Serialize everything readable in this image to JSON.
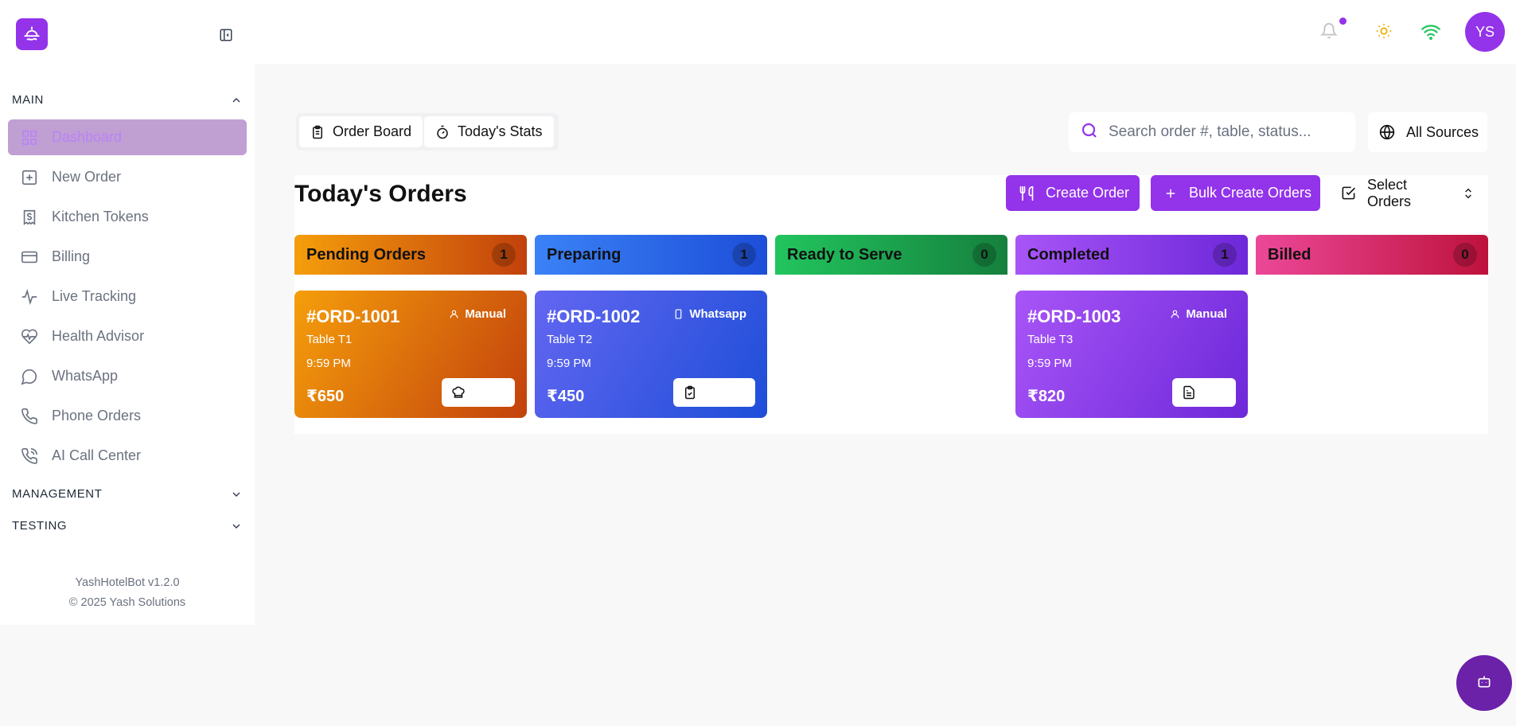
{
  "header": {
    "avatar_initials": "YS",
    "notification_dot": true,
    "icons": [
      "logo-icon",
      "sidebar-toggle-icon",
      "bell-icon",
      "sun-icon",
      "wifi-icon"
    ]
  },
  "sidebar": {
    "main_section": "MAIN",
    "items": [
      {
        "label": "Dashboard",
        "icon": "grid-icon",
        "active": true
      },
      {
        "label": "New Order",
        "icon": "plus-square-icon"
      },
      {
        "label": "Kitchen Tokens",
        "icon": "receipt-icon"
      },
      {
        "label": "Billing",
        "icon": "credit-card-icon"
      },
      {
        "label": "Live Tracking",
        "icon": "activity-icon"
      },
      {
        "label": "Health Advisor",
        "icon": "heart-pulse-icon"
      },
      {
        "label": "WhatsApp",
        "icon": "message-circle-icon"
      },
      {
        "label": "Phone Orders",
        "icon": "phone-icon"
      },
      {
        "label": "AI Call Center",
        "icon": "phone-call-icon"
      }
    ],
    "management_section": "MANAGEMENT",
    "testing_section": "TESTING",
    "version": "YashHotelBot v1.2.0",
    "copyright": "© 2025 Yash Solutions"
  },
  "toolbar": {
    "tabs": [
      {
        "label": "Order Board",
        "icon": "clipboard-icon"
      },
      {
        "label": "Today's Stats",
        "icon": "timer-icon"
      }
    ],
    "search_placeholder": "Search order #, table, status...",
    "sources_label": "All Sources"
  },
  "board": {
    "title": "Today's Orders",
    "create_label": "Create Order",
    "bulk_label": "Bulk Create Orders",
    "select_label": "Select Orders",
    "columns": [
      {
        "label": "Pending Orders",
        "count": "1",
        "gradient": [
          "#f59e0b",
          "#c2410c"
        ]
      },
      {
        "label": "Preparing",
        "count": "1",
        "gradient": [
          "#3b82f6",
          "#1d4ed8"
        ]
      },
      {
        "label": "Ready to Serve",
        "count": "0",
        "gradient": [
          "#22c55e",
          "#15803d"
        ]
      },
      {
        "label": "Completed",
        "count": "1",
        "gradient": [
          "#a855f7",
          "#6d28d9"
        ]
      },
      {
        "label": "Billed",
        "count": "0",
        "gradient": [
          "#ec4899",
          "#be123c"
        ]
      }
    ],
    "orders": [
      {
        "id": "#ORD-1001",
        "source": "Manual",
        "table": "Table T1",
        "time": "9:59 PM",
        "price": "₹650",
        "action": "Start",
        "column": 0,
        "gradient": [
          "#f59e0b",
          "#c2410c"
        ]
      },
      {
        "id": "#ORD-1002",
        "source": "Whatsapp",
        "table": "Table T2",
        "time": "9:59 PM",
        "price": "₹450",
        "action": "Ready",
        "column": 1,
        "gradient": [
          "#6366f1",
          "#1d4ed8"
        ]
      },
      {
        "id": "#ORD-1003",
        "source": "Manual",
        "table": "Table T3",
        "time": "9:59 PM",
        "price": "₹820",
        "action": "Bill",
        "column": 3,
        "gradient": [
          "#a855f7",
          "#6d28d9"
        ]
      }
    ]
  }
}
